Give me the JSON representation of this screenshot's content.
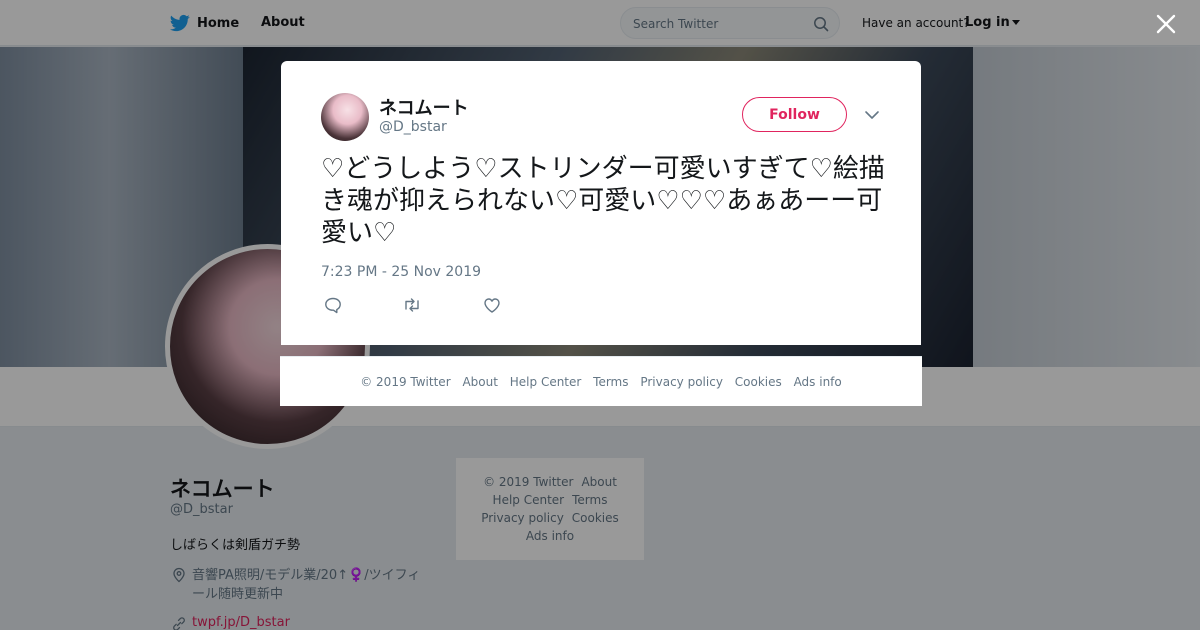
{
  "topbar": {
    "home_label": "Home",
    "about_label": "About",
    "search_placeholder": "Search Twitter",
    "have_account": "Have an account?",
    "login_label": "Log in"
  },
  "profile": {
    "name": "ネコムート",
    "handle": "@D_bstar",
    "bio": "しばらくは剣盾ガチ勢",
    "location": "音響PA照明/モデル業/20↑♀️/ツイフィール随時更新中",
    "url": "twpf.jp/D_bstar"
  },
  "side_footer": {
    "copyright": "© 2019 Twitter",
    "about": "About",
    "help_center": "Help Center",
    "terms": "Terms",
    "privacy": "Privacy policy",
    "cookies": "Cookies",
    "ads_info": "Ads info"
  },
  "tweet": {
    "name": "ネコムート",
    "handle": "@D_bstar",
    "follow_label": "Follow",
    "text": "♡どうしよう♡ストリンダー可愛いすぎて♡絵描き魂が抑えられない♡可愛い♡♡♡あぁあーー可愛い♡",
    "timestamp": "7:23 PM - 25 Nov 2019"
  },
  "modal_footer": {
    "copyright": "© 2019 Twitter",
    "about": "About",
    "help_center": "Help Center",
    "terms": "Terms",
    "privacy": "Privacy policy",
    "cookies": "Cookies",
    "ads_info": "Ads info"
  },
  "colors": {
    "brand_blue": "#1da1f2",
    "accent_pink": "#e0245e",
    "muted_text": "#657786"
  },
  "icons": [
    "twitter-bird-icon",
    "search-icon",
    "close-icon",
    "chevron-down-icon",
    "reply-icon",
    "retweet-icon",
    "heart-icon",
    "location-icon",
    "link-icon"
  ]
}
